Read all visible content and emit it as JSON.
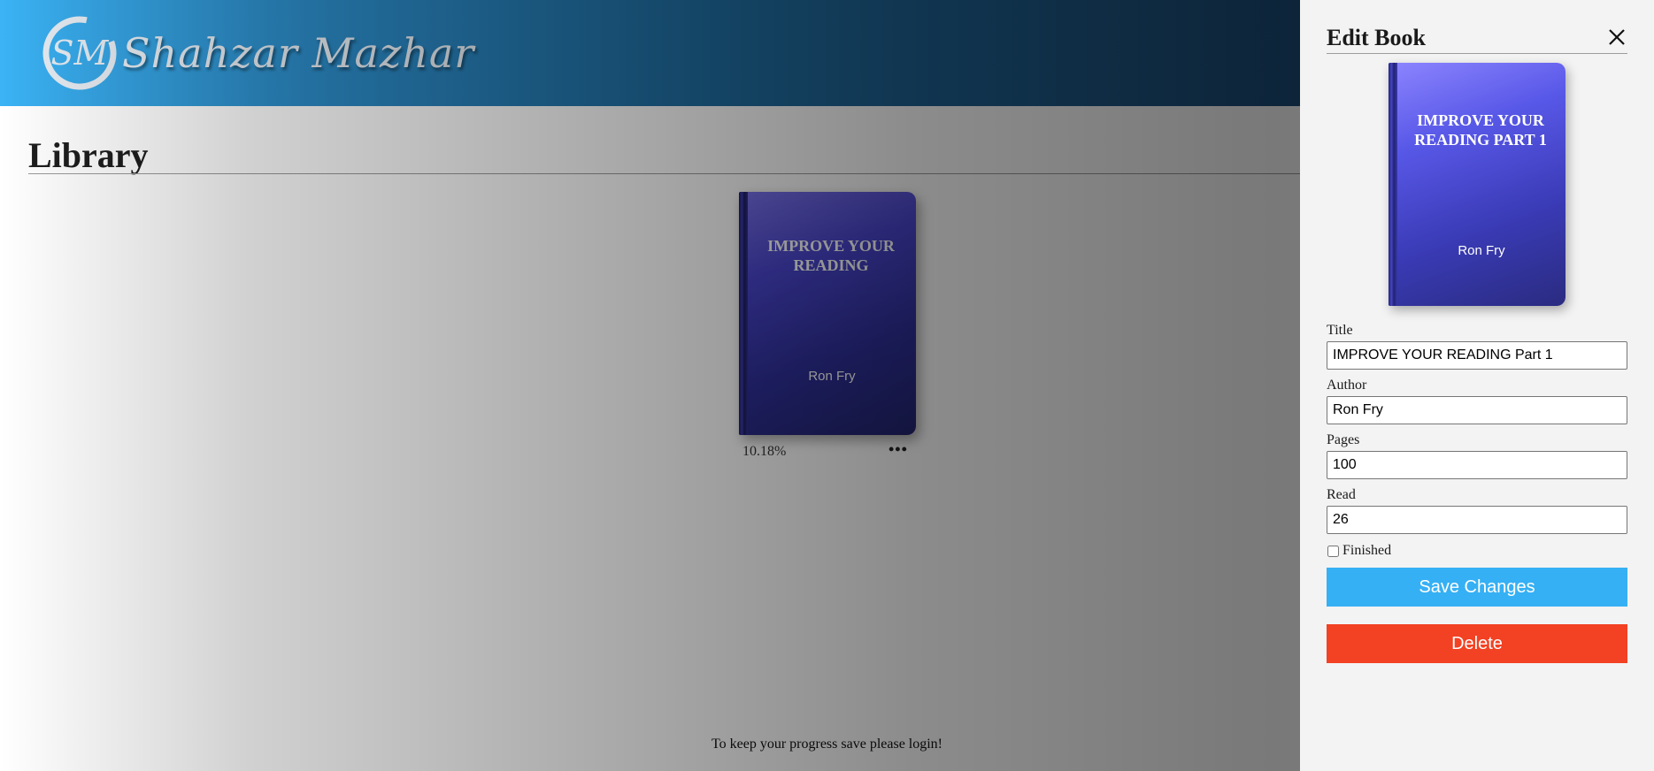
{
  "header": {
    "logo_monogram": "SM",
    "logo_text": "Shahzar Mazhar"
  },
  "library": {
    "title": "Library",
    "books": [
      {
        "cover_title": "IMPROVE YOUR READING",
        "author": "Ron Fry",
        "progress": "10.18%",
        "menu_label": "•••"
      }
    ],
    "footer_note": "To keep your progress save please login!"
  },
  "edit_panel": {
    "title": "Edit Book",
    "close_icon": "close-icon",
    "preview": {
      "cover_title": "IMPROVE YOUR READING PART 1",
      "author": "Ron Fry"
    },
    "fields": {
      "title": {
        "label": "Title",
        "value": "IMPROVE YOUR READING Part 1"
      },
      "author": {
        "label": "Author",
        "value": "Ron Fry"
      },
      "pages": {
        "label": "Pages",
        "value": "100"
      },
      "read": {
        "label": "Read",
        "value": "26"
      }
    },
    "finished": {
      "label": "Finished",
      "checked": false
    },
    "save_label": "Save Changes",
    "delete_label": "Delete"
  },
  "colors": {
    "header_gradient_start": "#3bb3f5",
    "header_gradient_end": "#1a3d66",
    "save_button": "#36b0f4",
    "delete_button": "#f24123",
    "panel_background": "#f3f3f3"
  }
}
